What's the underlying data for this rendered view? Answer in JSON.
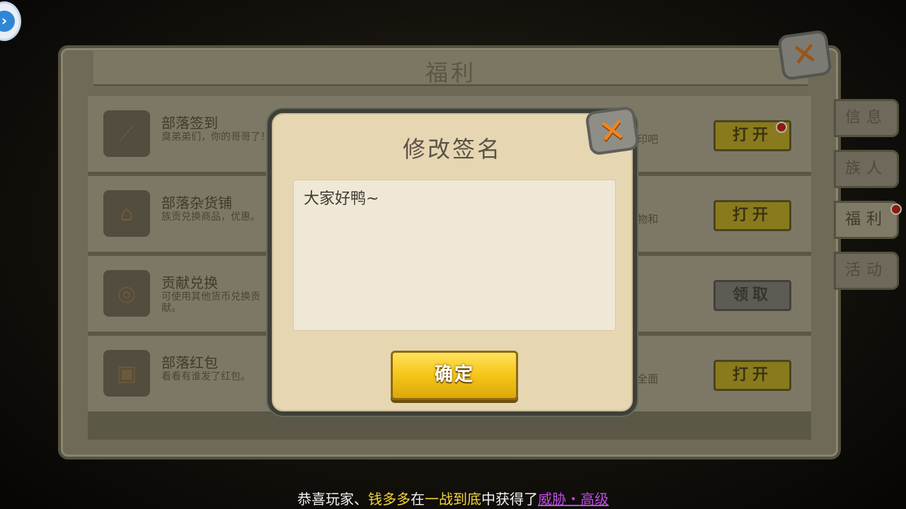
{
  "panel": {
    "title": "福利"
  },
  "rows": [
    {
      "title": "部落签到",
      "desc": "臭弟弟们，你的哥哥了！",
      "desc_right": "印吧",
      "button": "打开",
      "button_state": "active",
      "icon": "stick-icon",
      "has_dot": true
    },
    {
      "title": "部落杂货铺",
      "desc": "族贡兑换商品，优惠。",
      "desc_right": "物和",
      "button": "打开",
      "button_state": "active",
      "icon": "shop-icon",
      "has_dot": false
    },
    {
      "title": "贡献兑换",
      "desc": "可使用其他货币兑换贡献。",
      "desc_right": "",
      "button": "领取",
      "button_state": "disabled",
      "icon": "coin-exchange-icon",
      "has_dot": false
    },
    {
      "title": "部落红包",
      "desc": "看看有谁发了红包。",
      "desc_right": "全面",
      "button": "打开",
      "button_state": "active",
      "icon": "red-envelope-icon",
      "has_dot": false
    }
  ],
  "tabs": [
    {
      "label": "信息",
      "active": false,
      "has_dot": false
    },
    {
      "label": "族人",
      "active": false,
      "has_dot": false
    },
    {
      "label": "福利",
      "active": true,
      "has_dot": true
    },
    {
      "label": "活动",
      "active": false,
      "has_dot": false
    }
  ],
  "dialog": {
    "title": "修改签名",
    "signature_value": "大家好鸭~",
    "confirm_label": "确定"
  },
  "ticker": {
    "prefix": "恭喜玩家、",
    "player": "钱多多",
    "mid1": "在",
    "location": "一战到底",
    "mid2": "中获得了",
    "item": "威胁・高级"
  },
  "colors": {
    "accent_yellow": "#f5c518",
    "close_orange": "#f08420",
    "badge_red": "#8a1c12",
    "item_purple": "#c14ae6"
  }
}
